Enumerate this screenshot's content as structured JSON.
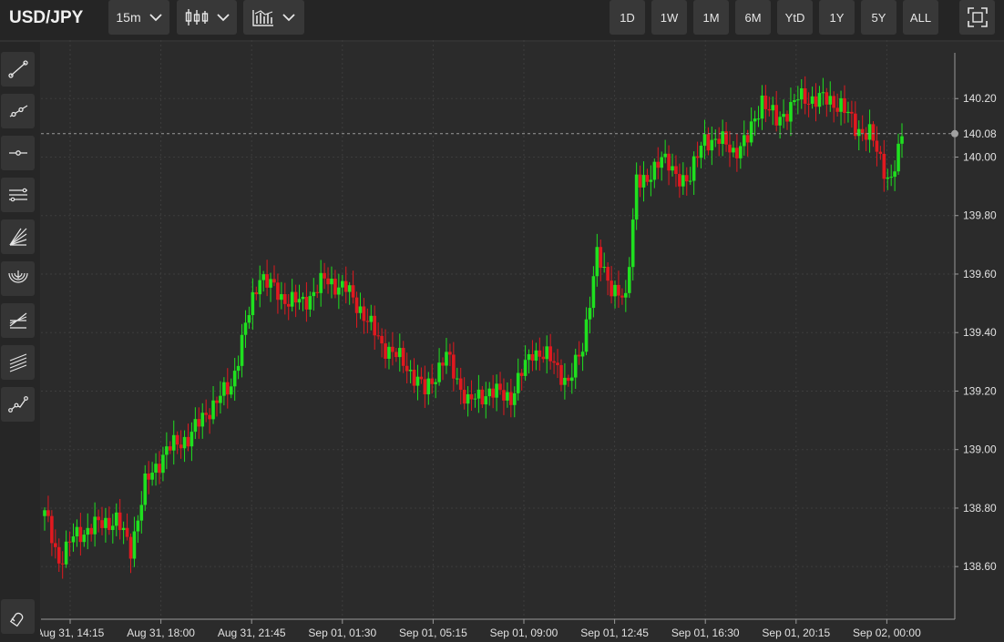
{
  "header": {
    "symbol": "USD/JPY",
    "interval": "15m",
    "chart_type_icon": "candlestick-icon",
    "indicators_icon": "indicators-icon",
    "ranges": [
      "1D",
      "1W",
      "1M",
      "6M",
      "YtD",
      "1Y",
      "5Y",
      "ALL"
    ],
    "fullscreen_icon": "fullscreen-icon"
  },
  "sidebar": {
    "tools": [
      "trend-line-icon",
      "ray-icon",
      "horizontal-line-icon",
      "parallel-channel-icon",
      "fan-icon",
      "arc-icon",
      "pitchfork-icon",
      "channel-lines-icon",
      "polyline-icon"
    ],
    "bottom_tool": "magnet-icon"
  },
  "colors": {
    "up": "#1fe01f",
    "down": "#e0191f",
    "background": "#2b2b2b",
    "grid": "#3d3d3d",
    "price_line": "#9a9a9a"
  },
  "chart_data": {
    "type": "candlestick",
    "title": "USD/JPY",
    "interval": "15m",
    "ylim": [
      138.42,
      140.4
    ],
    "y_ticks": [
      "140.20",
      "140.00",
      "139.80",
      "139.60",
      "139.40",
      "139.20",
      "139.00",
      "138.80",
      "138.60"
    ],
    "x_ticks": [
      "Aug 31, 14:15",
      "Aug 31, 18:00",
      "Aug 31, 21:45",
      "Sep 01, 01:30",
      "Sep 01, 05:15",
      "Sep 01, 09:00",
      "Sep 01, 12:45",
      "Sep 01, 16:30",
      "Sep 01, 20:15",
      "Sep 02, 00:00"
    ],
    "last_price": "140.08",
    "grid": true,
    "series_anchors": [
      [
        0,
        138.78
      ],
      [
        4,
        138.62
      ],
      [
        8,
        138.7
      ],
      [
        14,
        138.74
      ],
      [
        20,
        138.76
      ],
      [
        24,
        138.66
      ],
      [
        28,
        138.88
      ],
      [
        34,
        139.0
      ],
      [
        40,
        139.04
      ],
      [
        46,
        139.14
      ],
      [
        52,
        139.22
      ],
      [
        56,
        139.42
      ],
      [
        60,
        139.6
      ],
      [
        66,
        139.52
      ],
      [
        72,
        139.5
      ],
      [
        78,
        139.58
      ],
      [
        84,
        139.55
      ],
      [
        88,
        139.48
      ],
      [
        94,
        139.36
      ],
      [
        100,
        139.3
      ],
      [
        106,
        139.2
      ],
      [
        112,
        139.32
      ],
      [
        118,
        139.16
      ],
      [
        124,
        139.2
      ],
      [
        130,
        139.18
      ],
      [
        136,
        139.34
      ],
      [
        142,
        139.3
      ],
      [
        146,
        139.22
      ],
      [
        150,
        139.36
      ],
      [
        154,
        139.66
      ],
      [
        158,
        139.56
      ],
      [
        162,
        139.5
      ],
      [
        165,
        139.94
      ],
      [
        168,
        139.9
      ],
      [
        172,
        140.02
      ],
      [
        176,
        139.92
      ],
      [
        180,
        139.94
      ],
      [
        184,
        140.06
      ],
      [
        188,
        140.06
      ],
      [
        192,
        140.02
      ],
      [
        196,
        140.06
      ],
      [
        200,
        140.2
      ],
      [
        204,
        140.12
      ],
      [
        210,
        140.2
      ],
      [
        216,
        140.2
      ],
      [
        222,
        140.18
      ],
      [
        226,
        140.1
      ],
      [
        230,
        140.08
      ],
      [
        234,
        139.96
      ],
      [
        236,
        139.92
      ],
      [
        239,
        140.06
      ]
    ]
  }
}
